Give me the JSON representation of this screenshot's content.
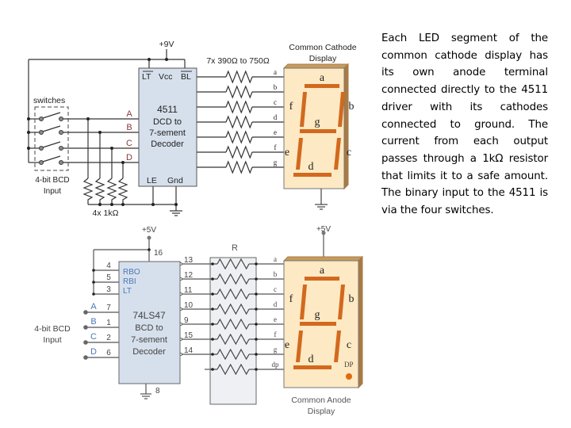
{
  "description": "Each LED segment of the common cathode display has its own anode terminal connected directly to the 4511 driver with its cathodes connected to ground. The current from each output passes through a 1kΩ resistor that limits it to a safe amount. The binary input to the 4511 is via the four switches.",
  "top_circuit": {
    "supply": "+9V",
    "switches_label": "switches",
    "input_label_line1": "4-bit BCD",
    "input_label_line2": "Input",
    "pull_down_label": "4x 1kΩ",
    "series_resistor_label": "7x 390Ω to 750Ω",
    "chip": {
      "pin_lt": "LT",
      "pin_vcc": "Vcc",
      "pin_bl": "BL",
      "name": "4511",
      "line2": "DCD to",
      "line3": "7-sement",
      "line4": "Decoder",
      "pin_le": "LE",
      "pin_gnd": "Gnd"
    },
    "inputs": [
      "A",
      "B",
      "C",
      "D"
    ],
    "segment_wires": [
      "a",
      "b",
      "c",
      "d",
      "e",
      "f",
      "g"
    ],
    "display_title_line1": "Common Cathode",
    "display_title_line2": "Display",
    "segments": [
      "a",
      "b",
      "c",
      "d",
      "e",
      "f",
      "g"
    ]
  },
  "bottom_circuit": {
    "supply_chip": "+5V",
    "supply_display": "+5V",
    "resistor_label": "R",
    "chip": {
      "pin_rbo": "RBO",
      "pin_rbi": "RBI",
      "pin_lt": "LT",
      "name": "74LS47",
      "line2": "BCD to",
      "line3": "7-sement",
      "line4": "Decoder",
      "vcc_pin": "16",
      "gnd_pin": "8"
    },
    "control_pins": [
      "4",
      "5",
      "3"
    ],
    "inputs": [
      {
        "label": "A",
        "pin": "7"
      },
      {
        "label": "B",
        "pin": "1"
      },
      {
        "label": "C",
        "pin": "2"
      },
      {
        "label": "D",
        "pin": "6"
      }
    ],
    "input_label_line1": "4-bit BCD",
    "input_label_line2": "Input",
    "output_pins": [
      "13",
      "12",
      "11",
      "10",
      "9",
      "15",
      "14"
    ],
    "segment_wires": [
      "a",
      "b",
      "c",
      "d",
      "e",
      "f",
      "g",
      "dp"
    ],
    "segments": [
      "a",
      "b",
      "c",
      "d",
      "e",
      "f",
      "g"
    ],
    "dp_label": "DP",
    "display_title_line1": "Common Anode",
    "display_title_line2": "Display"
  },
  "colors": {
    "chip_fill": "#d6e0ec",
    "display_fill": "#fde9c3",
    "display_edge": "#a87b44",
    "segment": "#d2691e",
    "wire": "#333333",
    "pin_label_blue": "#4a78b8",
    "input_label_red": "#8b3a3a"
  }
}
